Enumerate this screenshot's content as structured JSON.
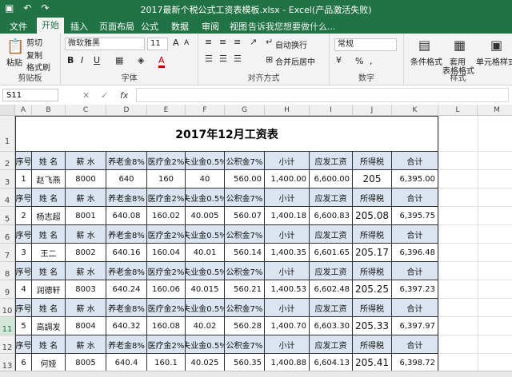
{
  "window": {
    "title": "2017最新个税公式工资表模板.xlsx - Excel(产品激活失败)"
  },
  "tabs": [
    "文件",
    "开始",
    "插入",
    "页面布局",
    "公式",
    "数据",
    "审阅",
    "视图"
  ],
  "tell_me": "告诉我您想要做什么...",
  "ribbon": {
    "clipboard": {
      "paste": "粘贴",
      "cut": "剪切",
      "copy": "复制",
      "format_painter": "格式刷",
      "label": "剪贴板"
    },
    "font": {
      "name": "微软雅黑",
      "size": "11",
      "label": "字体",
      "bold": "B",
      "italic": "I",
      "underline": "U",
      "grow": "A",
      "shrink": "A",
      "font_color": "A"
    },
    "alignment": {
      "wrap": "自动换行",
      "merge": "合并后居中",
      "label": "对齐方式"
    },
    "number": {
      "format": "常规",
      "label": "数字",
      "percent": "%",
      "comma": ","
    },
    "styles": {
      "cond": "条件格式",
      "table": "套用",
      "table2": "表格格式",
      "cell": "单元格样式",
      "label": "样式"
    }
  },
  "formula_bar": {
    "name_box": "S11",
    "fx": "fx",
    "cancel": "✕",
    "confirm": "✓"
  },
  "columns": [
    "A",
    "B",
    "C",
    "D",
    "E",
    "F",
    "G",
    "H",
    "I",
    "J",
    "K",
    "L",
    "M"
  ],
  "rows": [
    "1",
    "2",
    "3",
    "4",
    "5",
    "6",
    "7",
    "8",
    "9",
    "10",
    "11",
    "12",
    "13"
  ],
  "sheet_title": "2017年12月工资表",
  "headers": [
    "序号",
    "姓  名",
    "薪  水",
    "养老金8%",
    "医疗金2%",
    "失业金0.5%",
    "公积金7%",
    "小计",
    "应发工资",
    "所得税",
    "合计"
  ],
  "records": [
    [
      "1",
      "赵飞燕",
      "8000",
      "640",
      "160",
      "40",
      "560.00",
      "1,400.00",
      "6,600.00",
      "205",
      "6,395.00"
    ],
    [
      "2",
      "杨志超",
      "8001",
      "640.08",
      "160.02",
      "40.005",
      "560.07",
      "1,400.18",
      "6,600.83",
      "205.08",
      "6,395.75"
    ],
    [
      "3",
      "王二",
      "8002",
      "640.16",
      "160.04",
      "40.01",
      "560.14",
      "1,400.35",
      "6,601.65",
      "205.17",
      "6,396.48"
    ],
    [
      "4",
      "润德轩",
      "8003",
      "640.24",
      "160.06",
      "40.015",
      "560.21",
      "1,400.53",
      "6,602.48",
      "205.25",
      "6,397.23"
    ],
    [
      "5",
      "高調发",
      "8004",
      "640.32",
      "160.08",
      "40.02",
      "560.28",
      "1,400.70",
      "6,603.30",
      "205.33",
      "6,397.97"
    ],
    [
      "6",
      "何娅",
      "8005",
      "640.4",
      "160.1",
      "40.025",
      "560.35",
      "1,400.88",
      "6,604.13",
      "205.41",
      "6,398.72"
    ]
  ]
}
